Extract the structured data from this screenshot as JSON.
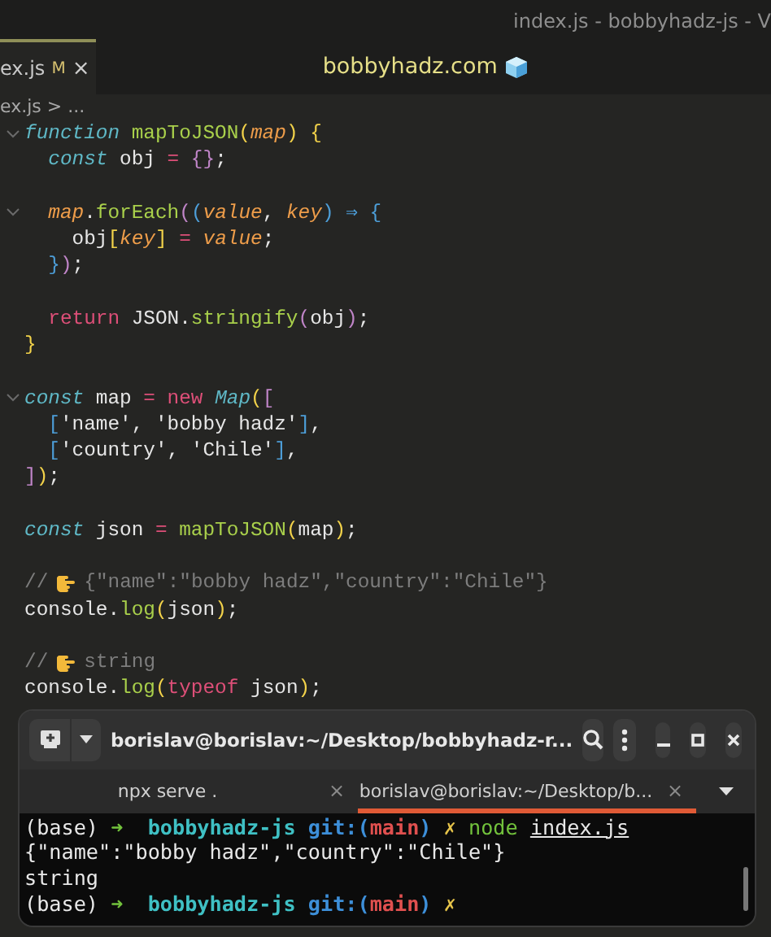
{
  "window": {
    "title": "index.js - bobbyhadz-js - V"
  },
  "editor_tab": {
    "label": "ex.js",
    "badge": "M",
    "close": "×",
    "selected": true
  },
  "banner": {
    "text": "bobbyhadz.com"
  },
  "breadcrumb": "ex.js > ...",
  "code": [
    {
      "fold": true,
      "blank_after": false,
      "tokens": [
        {
          "text": "function",
          "kind": "kw"
        },
        {
          "text": " mapToJSON",
          "kind": "fn"
        },
        {
          "text": "(",
          "kind": "y"
        },
        {
          "text": "map",
          "kind": "param"
        },
        {
          "text": ")",
          "kind": "y"
        },
        {
          "text": " {",
          "kind": "y"
        }
      ]
    },
    {
      "fold": false,
      "blank_after": true,
      "tokens": [
        {
          "text": "  const",
          "kind": "kw"
        },
        {
          "text": " obj",
          "kind": "p"
        },
        {
          "text": " =",
          "kind": "op"
        },
        {
          "text": " {}",
          "kind": "p2"
        },
        {
          "text": ";",
          "kind": "p"
        }
      ]
    },
    {
      "fold": true,
      "blank_after": false,
      "tokens": [
        {
          "text": "  map",
          "kind": "param"
        },
        {
          "text": ".",
          "kind": "p"
        },
        {
          "text": "forEach",
          "kind": "fn"
        },
        {
          "text": "(",
          "kind": "p2"
        },
        {
          "text": "(",
          "kind": "b"
        },
        {
          "text": "value",
          "kind": "param"
        },
        {
          "text": ", ",
          "kind": "p"
        },
        {
          "text": "key",
          "kind": "param"
        },
        {
          "text": ")",
          "kind": "b"
        },
        {
          "text": " ⇒",
          "kind": "b"
        },
        {
          "text": " {",
          "kind": "b"
        }
      ]
    },
    {
      "fold": false,
      "blank_after": false,
      "tokens": [
        {
          "text": "    obj",
          "kind": "p"
        },
        {
          "text": "[",
          "kind": "y"
        },
        {
          "text": "key",
          "kind": "param"
        },
        {
          "text": "]",
          "kind": "y"
        },
        {
          "text": " =",
          "kind": "op"
        },
        {
          "text": " value",
          "kind": "param"
        },
        {
          "text": ";",
          "kind": "p"
        }
      ]
    },
    {
      "fold": false,
      "blank_after": true,
      "tokens": [
        {
          "text": "  }",
          "kind": "b"
        },
        {
          "text": ")",
          "kind": "p2"
        },
        {
          "text": ";",
          "kind": "p"
        }
      ]
    },
    {
      "fold": false,
      "blank_after": false,
      "tokens": [
        {
          "text": "  return",
          "kind": "kwr"
        },
        {
          "text": " JSON.",
          "kind": "p"
        },
        {
          "text": "stringify",
          "kind": "fn"
        },
        {
          "text": "(",
          "kind": "p2"
        },
        {
          "text": "obj",
          "kind": "p"
        },
        {
          "text": ")",
          "kind": "p2"
        },
        {
          "text": ";",
          "kind": "p"
        }
      ]
    },
    {
      "fold": false,
      "blank_after": true,
      "tokens": [
        {
          "text": "}",
          "kind": "y"
        }
      ]
    },
    {
      "fold": true,
      "blank_after": false,
      "tokens": [
        {
          "text": "const",
          "kind": "kw"
        },
        {
          "text": " map",
          "kind": "p"
        },
        {
          "text": " =",
          "kind": "op"
        },
        {
          "text": " new",
          "kind": "kwr"
        },
        {
          "text": " Map",
          "kind": "kw"
        },
        {
          "text": "(",
          "kind": "y"
        },
        {
          "text": "[",
          "kind": "p2"
        }
      ]
    },
    {
      "fold": false,
      "blank_after": false,
      "tokens": [
        {
          "text": "  [",
          "kind": "b"
        },
        {
          "text": "'name', 'bobby hadz'",
          "kind": "p"
        },
        {
          "text": "]",
          "kind": "b"
        },
        {
          "text": ",",
          "kind": "p"
        }
      ]
    },
    {
      "fold": false,
      "blank_after": false,
      "tokens": [
        {
          "text": "  [",
          "kind": "b"
        },
        {
          "text": "'country', 'Chile'",
          "kind": "p"
        },
        {
          "text": "]",
          "kind": "b"
        },
        {
          "text": ",",
          "kind": "p"
        }
      ]
    },
    {
      "fold": false,
      "blank_after": true,
      "tokens": [
        {
          "text": "]",
          "kind": "p2"
        },
        {
          "text": ")",
          "kind": "y"
        },
        {
          "text": ";",
          "kind": "p"
        }
      ]
    },
    {
      "fold": false,
      "blank_after": true,
      "tokens": [
        {
          "text": "const",
          "kind": "kw"
        },
        {
          "text": " json",
          "kind": "p"
        },
        {
          "text": " =",
          "kind": "op"
        },
        {
          "text": " mapToJSON",
          "kind": "fn"
        },
        {
          "text": "(",
          "kind": "y"
        },
        {
          "text": "map",
          "kind": "p"
        },
        {
          "text": ")",
          "kind": "y"
        },
        {
          "text": ";",
          "kind": "p"
        }
      ]
    },
    {
      "fold": false,
      "blank_after": false,
      "tokens": [
        {
          "text": "//",
          "kind": "c"
        },
        {
          "kind": "hand"
        },
        {
          "text": "{\"name\":\"bobby hadz\",\"country\":\"Chile\"}",
          "kind": "c"
        }
      ]
    },
    {
      "fold": false,
      "blank_after": true,
      "tokens": [
        {
          "text": "console.",
          "kind": "p"
        },
        {
          "text": "log",
          "kind": "fn"
        },
        {
          "text": "(",
          "kind": "y"
        },
        {
          "text": "json",
          "kind": "p"
        },
        {
          "text": ")",
          "kind": "y"
        },
        {
          "text": ";",
          "kind": "p"
        }
      ]
    },
    {
      "fold": false,
      "blank_after": false,
      "tokens": [
        {
          "text": "//",
          "kind": "c"
        },
        {
          "kind": "hand"
        },
        {
          "text": "string",
          "kind": "c"
        }
      ]
    },
    {
      "fold": false,
      "blank_after": false,
      "tokens": [
        {
          "text": "console.",
          "kind": "p"
        },
        {
          "text": "log",
          "kind": "fn"
        },
        {
          "text": "(",
          "kind": "y"
        },
        {
          "text": "typeof",
          "kind": "kwr"
        },
        {
          "text": " json",
          "kind": "p"
        },
        {
          "text": ")",
          "kind": "y"
        },
        {
          "text": ";",
          "kind": "p"
        }
      ]
    }
  ],
  "terminal": {
    "title": "borislav@borislav:~/Desktop/bobbyhadz-r...",
    "tabs": [
      {
        "label": "npx serve .",
        "close": "×",
        "selected": false
      },
      {
        "label": "borislav@borislav:~/Desktop/b...",
        "close": "×",
        "selected": true
      }
    ],
    "lines": [
      [
        {
          "text": "(base) ",
          "kind": "tp"
        },
        {
          "text": "➜",
          "kind": "arrow"
        },
        {
          "text": "  bobbyhadz-js",
          "kind": "dir"
        },
        {
          "text": " git:(",
          "kind": "git"
        },
        {
          "text": "main",
          "kind": "branch"
        },
        {
          "text": ")",
          "kind": "git"
        },
        {
          "text": " ✗",
          "kind": "x"
        },
        {
          "text": " node ",
          "kind": "cmd"
        },
        {
          "text": "index.js",
          "kind": "link"
        }
      ],
      [
        {
          "text": "{\"name\":\"bobby hadz\",\"country\":\"Chile\"}",
          "kind": "tp"
        }
      ],
      [
        {
          "text": "string",
          "kind": "tp"
        }
      ],
      [
        {
          "text": "(base) ",
          "kind": "tp"
        },
        {
          "text": "➜",
          "kind": "arrow"
        },
        {
          "text": "  bobbyhadz-js",
          "kind": "dir"
        },
        {
          "text": " git:(",
          "kind": "git"
        },
        {
          "text": "main",
          "kind": "branch"
        },
        {
          "text": ")",
          "kind": "git"
        },
        {
          "text": " ✗",
          "kind": "x"
        }
      ]
    ]
  }
}
